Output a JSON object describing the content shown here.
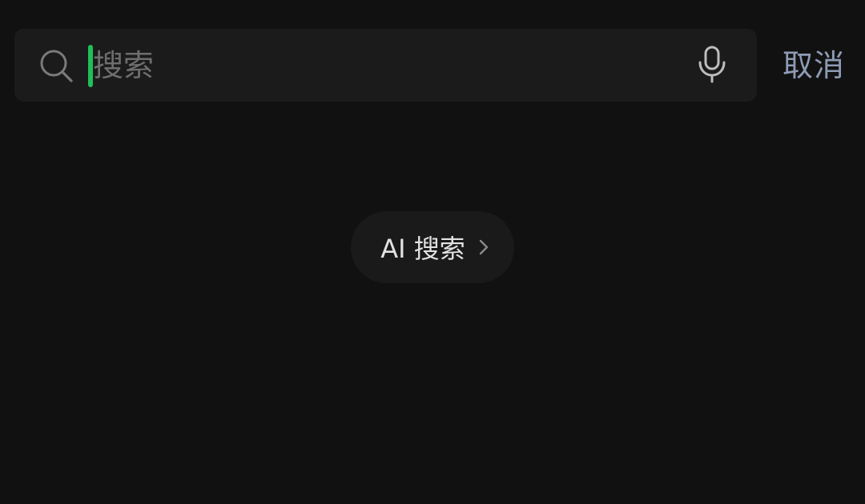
{
  "search": {
    "value": "",
    "placeholder": "搜索",
    "caret_color": "#1fbf5a",
    "search_icon": "search-icon",
    "mic_icon": "microphone-icon"
  },
  "header": {
    "cancel_label": "取消"
  },
  "main": {
    "ai_search_label": "AI 搜索",
    "ai_search_icon": "chevron-right-icon"
  },
  "colors": {
    "background": "#111111",
    "search_bar": "#1b1b1b",
    "cancel_text": "#8e9bb5",
    "placeholder_text": "#6e6e6e"
  }
}
